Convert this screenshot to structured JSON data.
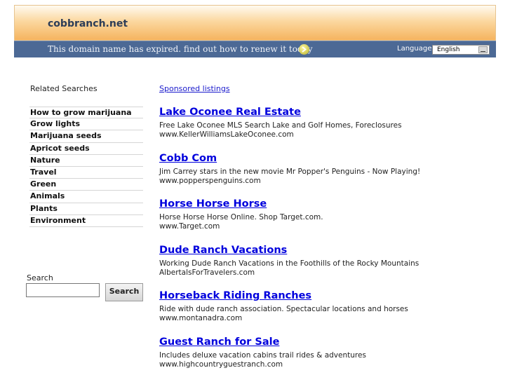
{
  "header": {
    "site_title": "cobbranch.net",
    "expired_message": "This domain name has expired. find out how to renew it today",
    "language_label": "Language:",
    "language_selected": "English",
    "colors": {
      "header_orange": "#f5b45f",
      "bar_blue": "#4c6995",
      "link_blue": "#0000dd"
    }
  },
  "sidebar": {
    "title": "Related Searches",
    "items": [
      "How to grow marijuana",
      "Grow lights",
      "Marijuana seeds",
      "Apricot seeds",
      "Nature",
      "Travel",
      "Green",
      "Animals",
      "Plants",
      "Environment"
    ],
    "search": {
      "label": "Search",
      "value": "",
      "button": "Search"
    }
  },
  "main": {
    "sponsored_label": "Sponsored listings",
    "listings": [
      {
        "title": "Lake Oconee Real Estate",
        "desc": "Free Lake Oconee MLS Search Lake and Golf Homes, Foreclosures",
        "url": "www.KellerWilliamsLakeOconee.com"
      },
      {
        "title": "Cobb Com",
        "desc": "Jim Carrey stars in the new movie Mr Popper's Penguins - Now Playing!",
        "url": "www.popperspenguins.com"
      },
      {
        "title": "Horse Horse Horse",
        "desc": "Horse Horse Horse Online. Shop Target.com.",
        "url": "www.Target.com"
      },
      {
        "title": "Dude Ranch Vacations",
        "desc": "Working Dude Ranch Vacations in the Foothills of the Rocky Mountains",
        "url": "AlbertalsForTravelers.com"
      },
      {
        "title": "Horseback Riding Ranches",
        "desc": "Ride with dude ranch association. Spectacular locations and horses",
        "url": "www.montanadra.com"
      },
      {
        "title": "Guest Ranch for Sale",
        "desc": "Includes deluxe vacation cabins trail rides & adventures",
        "url": "www.highcountryguestranch.com"
      }
    ]
  }
}
